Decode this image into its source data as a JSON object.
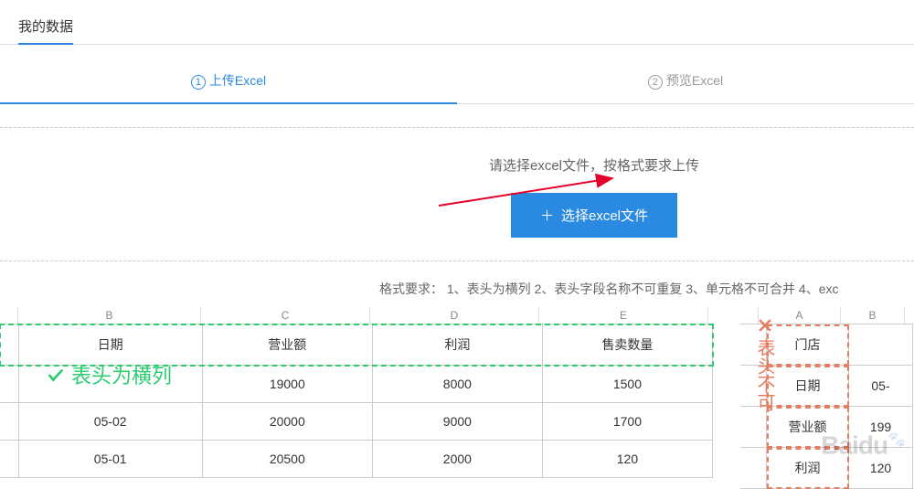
{
  "topTab": {
    "label": "我的数据"
  },
  "steps": {
    "s1": {
      "num": "1",
      "label": "上传Excel"
    },
    "s2": {
      "num": "2",
      "label": "预览Excel"
    }
  },
  "upload": {
    "hint": "请选择excel文件，按格式要求上传",
    "btn": "选择excel文件"
  },
  "formatReq": "格式要求：  1、表头为横列   2、表头字段名称不可重复   3、单元格不可合并   4、exc",
  "goodExample": {
    "columns": {
      "b": "B",
      "c": "C",
      "d": "D",
      "e": "E"
    },
    "headers": {
      "date": "日期",
      "revenue": "营业额",
      "profit": "利润",
      "qty": "售卖数量"
    },
    "rows": [
      {
        "date": "",
        "revenue": "19000",
        "profit": "8000",
        "qty": "1500"
      },
      {
        "date": "05-02",
        "revenue": "20000",
        "profit": "9000",
        "qty": "1700"
      },
      {
        "date": "05-01",
        "revenue": "20500",
        "profit": "2000",
        "qty": "120"
      }
    ],
    "label": "表头为横列"
  },
  "badExample": {
    "columns": {
      "a": "A",
      "b": "B"
    },
    "rows": [
      {
        "h": "门店",
        "v": ""
      },
      {
        "h": "日期",
        "v": "05-"
      },
      {
        "h": "营业额",
        "v": "199"
      },
      {
        "h": "利润",
        "v": "120"
      }
    ],
    "label": "表头不可"
  },
  "watermark": "Baidu"
}
